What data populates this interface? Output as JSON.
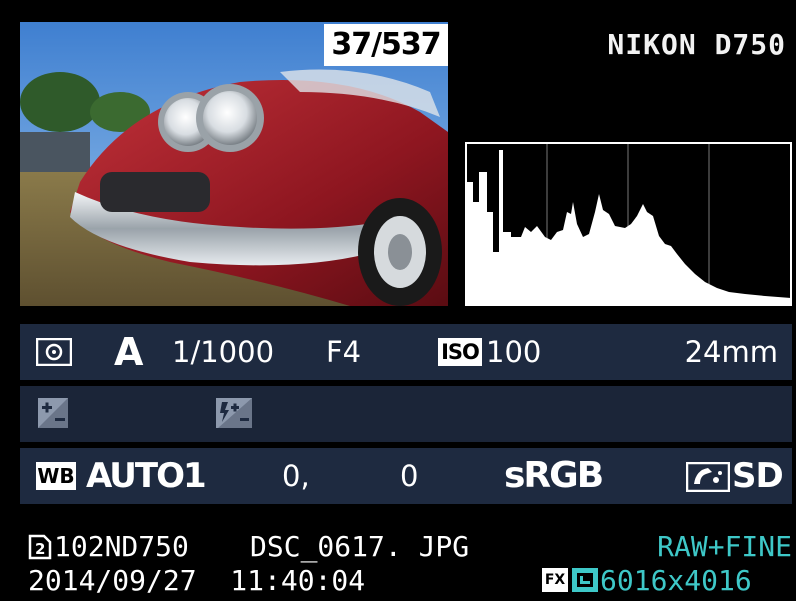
{
  "display": {
    "frame_counter": "37/537",
    "camera_model": "NIKON D750"
  },
  "shooting_info": {
    "metering_icon": "matrix-metering-icon",
    "mode": "A",
    "shutter_speed": "1/1000",
    "aperture": "F4",
    "iso_label": "ISO",
    "iso_value": "100",
    "focal_length": "24mm",
    "exposure_comp_icon": "exposure-compensation-icon",
    "flash_comp_icon": "flash-compensation-icon",
    "wb_label": "WB",
    "white_balance": "AUTO1",
    "wb_fine_tune_a": "0,",
    "wb_fine_tune_b": "0",
    "color_space": "sRGB",
    "picture_control_icon": "picture-control-icon",
    "picture_control": "SD"
  },
  "file_info": {
    "slot_icon": "card-slot-2-icon",
    "folder": "102ND750",
    "filename": "DSC_0617. JPG",
    "image_quality": "RAW+FINE",
    "datetime": "2014/09/27  11:40:04",
    "format_badge": "FX",
    "size_icon": "image-size-large-icon",
    "image_size": "6016x4016"
  },
  "colors": {
    "panel_bg": "#1e2a40",
    "accent_cyan": "#3ec8c8",
    "text_white": "#ffffff"
  }
}
